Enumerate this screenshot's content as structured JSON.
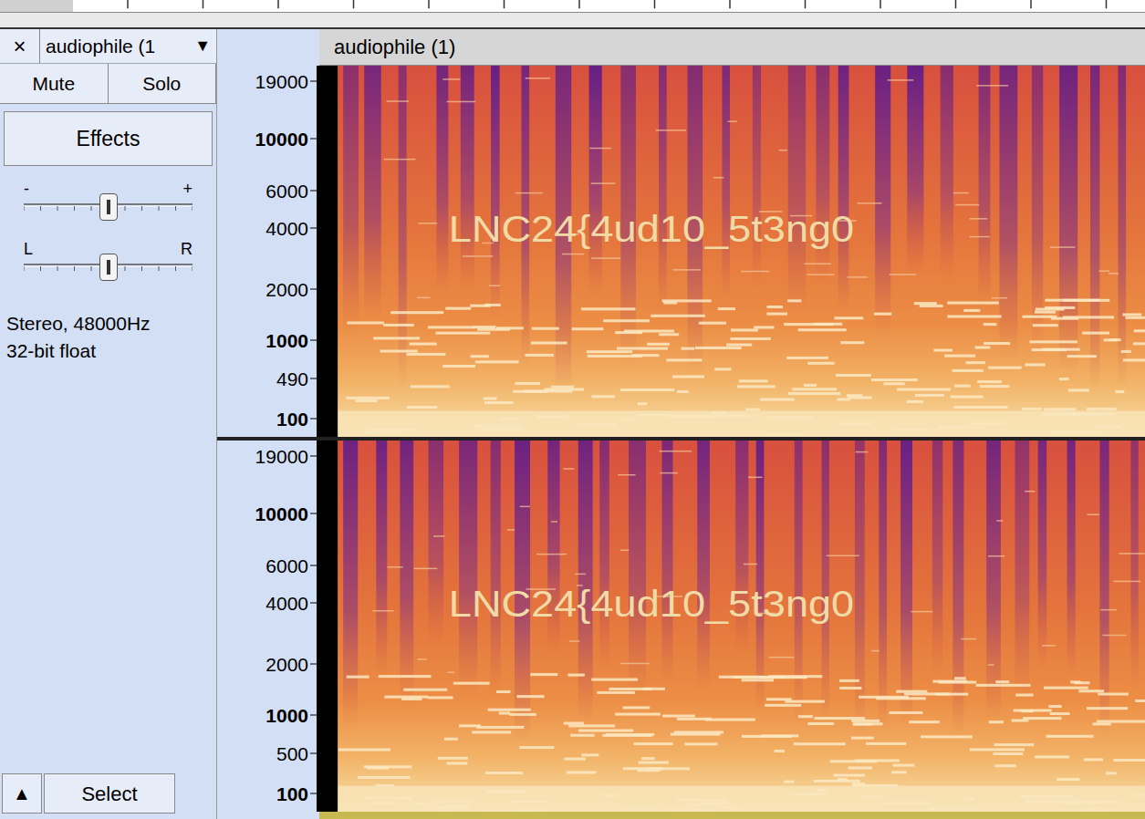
{
  "track": {
    "close_icon": "×",
    "name": "audiophile (1",
    "dropdown_icon": "▼",
    "title": "audiophile (1)",
    "buttons": [
      {
        "label": "Mute",
        "selected": false
      },
      {
        "label": "Solo",
        "selected": false
      }
    ],
    "effects_button": "Effects",
    "gain": {
      "min_label": "-",
      "max_label": "+",
      "level": 0.5
    },
    "pan": {
      "left_label": "L",
      "right_label": "R",
      "level": 0.5
    },
    "info": [
      "Stereo, 48000Hz",
      "32-bit float"
    ],
    "collapse_icon": "▲",
    "select_button": "Select"
  },
  "channels": [
    {
      "scale": [
        {
          "label": "19000",
          "bold": false
        },
        {
          "label": "10000",
          "bold": true
        },
        {
          "label": "6000",
          "bold": false
        },
        {
          "label": "4000",
          "bold": false
        },
        {
          "label": "2000",
          "bold": false
        },
        {
          "label": "1000",
          "bold": true
        },
        {
          "label": "490",
          "bold": false
        },
        {
          "label": "100",
          "bold": true
        }
      ],
      "overlay_text": "LNC24{4ud10_5t3ng0"
    },
    {
      "scale": [
        {
          "label": "19000",
          "bold": false
        },
        {
          "label": "10000",
          "bold": true
        },
        {
          "label": "6000",
          "bold": false
        },
        {
          "label": "4000",
          "bold": false
        },
        {
          "label": "2000",
          "bold": false
        },
        {
          "label": "1000",
          "bold": true
        },
        {
          "label": "500",
          "bold": false
        },
        {
          "label": "100",
          "bold": true
        }
      ],
      "overlay_text": "LNC24{4ud10_5t3ng0"
    }
  ]
}
